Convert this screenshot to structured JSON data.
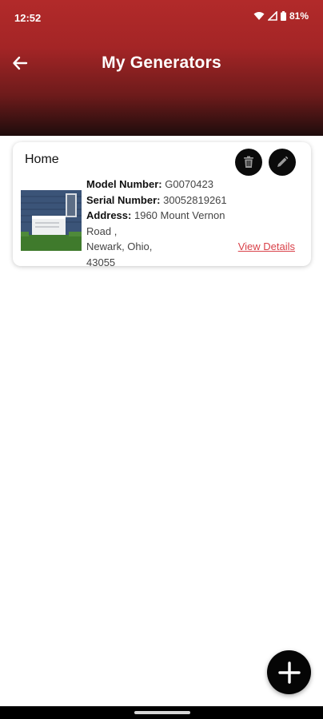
{
  "status_bar": {
    "time": "12:52",
    "battery": "81%"
  },
  "header": {
    "title": "My Generators",
    "back_icon": "arrow-left-icon"
  },
  "generators": [
    {
      "name": "Home",
      "model_label": "Model Number:",
      "model_value": "G0070423",
      "serial_label": "Serial Number:",
      "serial_value": "30052819261",
      "address_label": "Address:",
      "address_line1": "1960 Mount Vernon",
      "address_line2": "Road ,",
      "address_line3": "Newark, Ohio,",
      "address_line4": "43055",
      "view_details": "View Details",
      "delete_icon": "trash-icon",
      "edit_icon": "pencil-icon"
    }
  ],
  "fab": {
    "icon": "plus-icon"
  },
  "colors": {
    "header_top": "#b22a2a",
    "header_bottom": "#1e0c0c",
    "link": "#d9424a",
    "button_dark": "#0b0b0b"
  }
}
